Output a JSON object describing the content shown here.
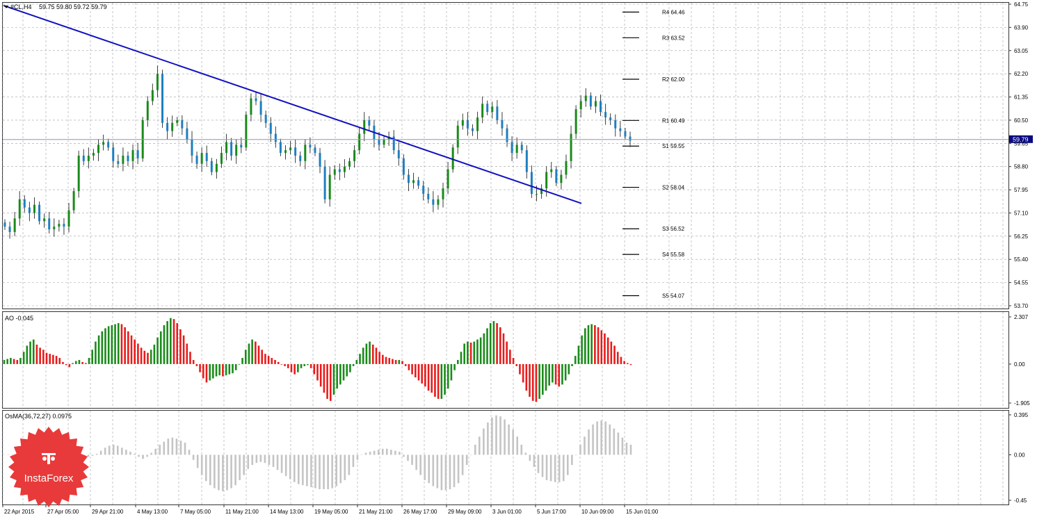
{
  "header": {
    "symbol": "#CL,H4",
    "ohlc": "59.75 59.80 59.72 59.79"
  },
  "colors": {
    "bull": "#1a8a1a",
    "bear": "#e81b1b",
    "wick": "#3a3a3a",
    "trendline": "#1010c0",
    "grid": "#9aa0a6",
    "osma": "#c4c4c4",
    "price_box": "#0a0a80",
    "logo": "#e83a3a"
  },
  "price_panel": {
    "y_ticks": [
      "64.75",
      "63.90",
      "63.05",
      "62.20",
      "61.35",
      "60.50",
      "59.65",
      "58.80",
      "57.95",
      "57.10",
      "56.25",
      "55.40",
      "54.55",
      "53.70"
    ],
    "ylim": [
      53.7,
      64.75
    ],
    "current_price": "59.79",
    "pivots": [
      {
        "label": "R4",
        "value": "64.46"
      },
      {
        "label": "R3",
        "value": "63.52"
      },
      {
        "label": "R2",
        "value": "62.00"
      },
      {
        "label": "R1",
        "value": "60.49"
      },
      {
        "label": "S1",
        "value": "59.55"
      },
      {
        "label": "S2",
        "value": "58.04"
      },
      {
        "label": "S3",
        "value": "56.52"
      },
      {
        "label": "S4",
        "value": "55.58"
      },
      {
        "label": "S5",
        "value": "54.07"
      }
    ]
  },
  "ao_panel": {
    "label": "AO -0.045",
    "y_ticks": [
      "2.307",
      "0.00",
      "-1.905"
    ]
  },
  "osma_panel": {
    "label": "OsMA(36,72,27) 0.0975",
    "y_ticks": [
      "0.395",
      "0.00",
      "-0.45"
    ]
  },
  "x_ticks": [
    "22 Apr 2015",
    "27 Apr 05:00",
    "29 Apr 21:00",
    "4 May 13:00",
    "7 May 05:00",
    "11 May 21:00",
    "14 May 13:00",
    "19 May 05:00",
    "21 May 21:00",
    "26 May 17:00",
    "29 May 09:00",
    "3 Jun 01:00",
    "5 Jun 17:00",
    "10 Jun 09:00",
    "15 Jun 01:00"
  ],
  "logo": {
    "text": "InstaForex",
    "icon": "instaforex-logo-icon"
  },
  "chart_data": [
    {
      "type": "candlestick",
      "title": "#CL,H4",
      "series_close": [
        56.6,
        56.4,
        56.9,
        57.6,
        57.3,
        57.1,
        57.4,
        56.8,
        56.9,
        56.5,
        56.6,
        56.7,
        56.6,
        57.2,
        57.9,
        59.2,
        59.0,
        59.2,
        59.3,
        59.6,
        59.7,
        59.5,
        59.0,
        58.9,
        59.2,
        59.0,
        59.4,
        59.1,
        60.5,
        61.2,
        61.6,
        62.2,
        60.4,
        60.1,
        60.4,
        60.5,
        60.2,
        59.8,
        59.2,
        58.9,
        59.3,
        59.0,
        58.6,
        58.9,
        59.3,
        59.7,
        59.2,
        59.6,
        59.5,
        60.7,
        61.3,
        61.2,
        60.7,
        60.4,
        60.0,
        59.7,
        59.3,
        59.4,
        59.5,
        59.2,
        59.0,
        59.6,
        59.5,
        59.3,
        58.8,
        57.6,
        58.5,
        58.7,
        58.6,
        58.8,
        59.0,
        59.4,
        60.0,
        60.5,
        60.3,
        59.8,
        59.6,
        59.8,
        59.9,
        59.4,
        59.1,
        58.5,
        58.2,
        58.3,
        58.1,
        57.8,
        57.6,
        57.4,
        57.6,
        58.0,
        58.7,
        59.5,
        60.3,
        60.5,
        60.2,
        60.1,
        60.6,
        61.1,
        60.8,
        61.0,
        60.5,
        60.2,
        59.7,
        59.3,
        59.6,
        59.4,
        58.6,
        57.8,
        57.8,
        58.0,
        58.6,
        58.7,
        58.2,
        58.5,
        59.0,
        60.0,
        60.9,
        61.2,
        61.4,
        61.0,
        61.2,
        60.8,
        60.6,
        60.5,
        60.2,
        60.1,
        59.9,
        59.75
      ],
      "pivots": {
        "R4": 64.46,
        "R3": 63.52,
        "R2": 62.0,
        "R1": 60.49,
        "S1": 59.55,
        "S2": 58.04,
        "S3": 56.52,
        "S4": 55.58,
        "S5": 54.07
      },
      "trendline": {
        "from_price": 64.7,
        "to_price": 57.45
      }
    },
    {
      "type": "bar",
      "title": "AO -0.045",
      "ylim": [
        -1.905,
        2.307
      ],
      "values": [
        0.2,
        0.25,
        0.3,
        0.25,
        0.2,
        0.3,
        0.6,
        0.9,
        1.1,
        1.2,
        0.95,
        0.8,
        0.7,
        0.55,
        0.5,
        0.45,
        0.4,
        0.3,
        0.1,
        -0.05,
        -0.15,
        0.05,
        0.15,
        0.2,
        0.1,
        0.05,
        0.3,
        0.7,
        1.1,
        1.4,
        1.6,
        1.75,
        1.85,
        1.9,
        1.95,
        2.0,
        1.95,
        1.8,
        1.6,
        1.4,
        1.2,
        1.0,
        0.8,
        0.65,
        0.55,
        0.7,
        0.95,
        1.3,
        1.6,
        1.9,
        2.1,
        2.25,
        2.2,
        2.0,
        1.7,
        1.4,
        1.0,
        0.6,
        0.2,
        -0.1,
        -0.4,
        -0.7,
        -0.9,
        -0.8,
        -0.7,
        -0.6,
        -0.55,
        -0.6,
        -0.55,
        -0.5,
        -0.45,
        -0.3,
        0.0,
        0.3,
        0.7,
        1.0,
        1.2,
        1.1,
        0.9,
        0.7,
        0.5,
        0.4,
        0.3,
        0.2,
        0.1,
        0.0,
        -0.1,
        -0.2,
        -0.4,
        -0.5,
        -0.4,
        -0.2,
        -0.1,
        -0.05,
        -0.2,
        -0.5,
        -0.8,
        -1.1,
        -1.4,
        -1.7,
        -1.8,
        -1.5,
        -1.2,
        -1.0,
        -0.8,
        -0.6,
        -0.4,
        -0.1,
        0.2,
        0.5,
        0.8,
        1.0,
        1.1,
        0.95,
        0.8,
        0.6,
        0.45,
        0.35,
        0.3,
        0.25,
        0.2,
        0.2,
        0.15,
        -0.1,
        -0.3,
        -0.5,
        -0.65,
        -0.8,
        -0.95,
        -1.1,
        -1.3,
        -1.4,
        -1.6,
        -1.7,
        -1.7,
        -1.5,
        -1.2,
        -0.8,
        -0.3,
        0.2,
        0.6,
        1.0,
        1.1,
        1.05,
        1.1,
        1.2,
        1.3,
        1.5,
        1.75,
        2.0,
        2.1,
        2.0,
        1.8,
        1.5,
        1.1,
        0.7,
        0.3,
        -0.1,
        -0.5,
        -0.9,
        -1.3,
        -1.6,
        -1.8,
        -1.85,
        -1.7,
        -1.5,
        -1.3,
        -1.05,
        -0.9,
        -1.0,
        -1.1,
        -1.0,
        -0.8,
        -0.5,
        -0.1,
        0.4,
        0.9,
        1.4,
        1.75,
        1.9,
        1.95,
        1.9,
        1.8,
        1.65,
        1.5,
        1.3,
        1.1,
        0.9,
        0.6,
        0.35,
        0.15,
        0.05,
        -0.045
      ]
    },
    {
      "type": "bar",
      "title": "OsMA(36,72,27) 0.0975",
      "ylim": [
        -0.45,
        0.395
      ],
      "values": [
        0.0,
        0.0,
        0.0,
        0.0,
        0.0,
        0.0,
        0.0,
        0.0,
        0.0,
        0.0,
        0.0,
        0.0,
        0.0,
        -0.02,
        -0.05,
        -0.08,
        -0.1,
        -0.08,
        -0.05,
        -0.03,
        -0.02,
        -0.01,
        0.01,
        0.04,
        0.07,
        0.09,
        0.1,
        0.09,
        0.07,
        0.05,
        0.03,
        0.01,
        -0.02,
        -0.04,
        -0.02,
        0.02,
        0.06,
        0.1,
        0.13,
        0.16,
        0.17,
        0.16,
        0.14,
        0.12,
        0.05,
        -0.05,
        -0.13,
        -0.2,
        -0.26,
        -0.3,
        -0.33,
        -0.35,
        -0.36,
        -0.35,
        -0.33,
        -0.3,
        -0.25,
        -0.2,
        -0.14,
        -0.1,
        -0.08,
        -0.07,
        -0.08,
        -0.1,
        -0.12,
        -0.15,
        -0.18,
        -0.21,
        -0.24,
        -0.27,
        -0.29,
        -0.3,
        -0.31,
        -0.32,
        -0.33,
        -0.34,
        -0.34,
        -0.34,
        -0.33,
        -0.31,
        -0.28,
        -0.25,
        -0.2,
        -0.12,
        -0.05,
        0.0,
        0.02,
        0.03,
        0.04,
        0.05,
        0.06,
        0.06,
        0.05,
        0.04,
        0.03,
        -0.02,
        -0.06,
        -0.1,
        -0.15,
        -0.2,
        -0.25,
        -0.28,
        -0.31,
        -0.33,
        -0.35,
        -0.35,
        -0.34,
        -0.32,
        -0.28,
        -0.2,
        -0.1,
        0.0,
        0.1,
        0.18,
        0.26,
        0.32,
        0.37,
        0.39,
        0.38,
        0.35,
        0.3,
        0.25,
        0.18,
        0.1,
        0.02,
        -0.06,
        -0.12,
        -0.18,
        -0.22,
        -0.25,
        -0.26,
        -0.27,
        -0.27,
        -0.26,
        -0.2,
        -0.1,
        0.0,
        0.1,
        0.18,
        0.25,
        0.3,
        0.33,
        0.34,
        0.33,
        0.3,
        0.26,
        0.22,
        0.17,
        0.12,
        0.1
      ]
    }
  ]
}
